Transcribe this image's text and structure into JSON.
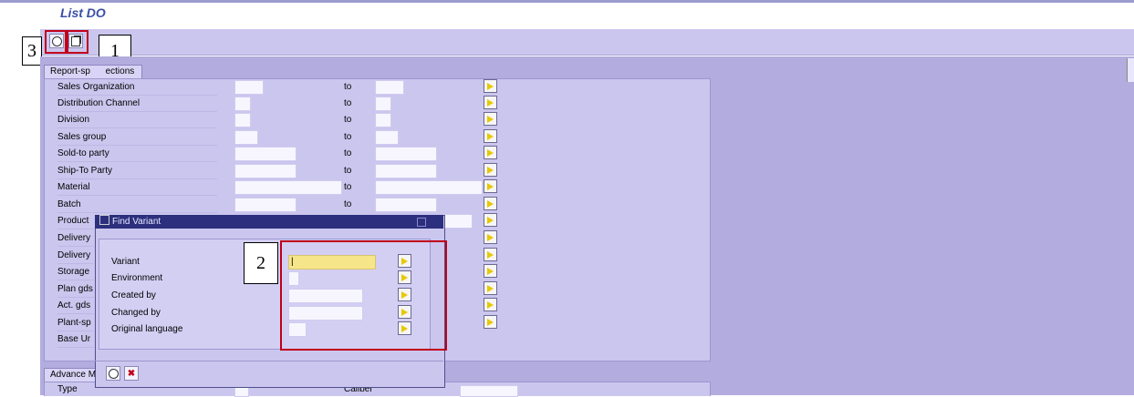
{
  "window": {
    "title": "List DO"
  },
  "toolbar": {
    "execute_icon": "execute-clock-icon",
    "variant_icon": "get-variant-icon"
  },
  "callouts": {
    "one": "1",
    "two": "2",
    "three": "3"
  },
  "selections": {
    "tab_label": "Report-sp",
    "tab_label_rest": "ections",
    "to_label": "to",
    "rows": [
      {
        "label": "Sales Organization"
      },
      {
        "label": "Distribution Channel"
      },
      {
        "label": "Division"
      },
      {
        "label": "Sales group"
      },
      {
        "label": "Sold-to party"
      },
      {
        "label": "Ship-To Party"
      },
      {
        "label": "Material"
      },
      {
        "label": "Batch"
      },
      {
        "label": "Product"
      },
      {
        "label": "Delivery"
      },
      {
        "label": "Delivery"
      },
      {
        "label": "Storage"
      },
      {
        "label": "Plan gds"
      },
      {
        "label": "Act. gds"
      },
      {
        "label": "Plant-sp"
      },
      {
        "label": "Base Ur"
      }
    ]
  },
  "advanced": {
    "tab_label": "Advance M",
    "type_label": "Type",
    "caliber_label": "Caliber"
  },
  "dialog": {
    "title": "Find Variant",
    "fields": [
      {
        "label": "Variant",
        "value": "|"
      },
      {
        "label": "Environment",
        "value": ""
      },
      {
        "label": "Created by",
        "value": ""
      },
      {
        "label": "Changed by",
        "value": ""
      },
      {
        "label": "Original language",
        "value": ""
      }
    ],
    "colors": {
      "active_field": "#f7e58a",
      "title_bar": "#2c2f7d"
    }
  }
}
